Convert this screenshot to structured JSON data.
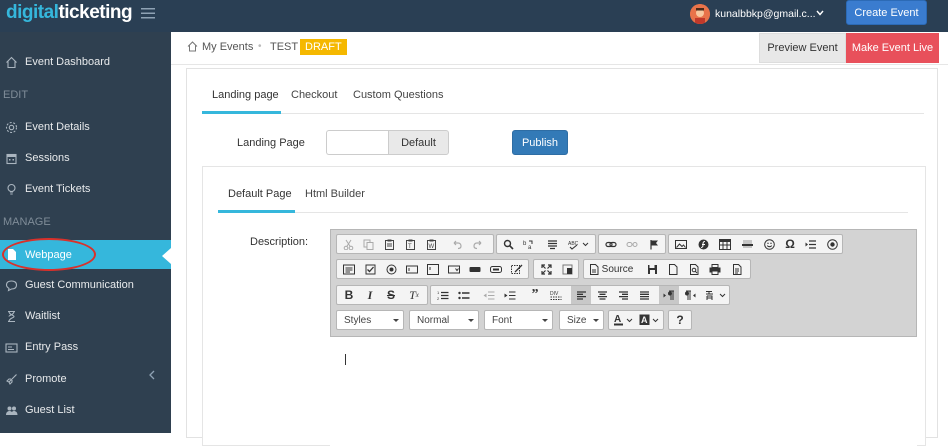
{
  "brand": {
    "logo_part1": "digital",
    "logo_part2": "ticketing"
  },
  "header": {
    "user_email": "kunalbbkp@gmail.c...",
    "create_event_label": "Create Event"
  },
  "sidebar": {
    "dashboard": "Event Dashboard",
    "section_edit": "EDIT",
    "event_details": "Event Details",
    "sessions": "Sessions",
    "event_tickets": "Event Tickets",
    "section_manage": "MANAGE",
    "webpage": "Webpage",
    "guest_communication": "Guest Communication",
    "waitlist": "Waitlist",
    "entry_pass": "Entry Pass",
    "promote": "Promote",
    "guest_list": "Guest List"
  },
  "breadcrumb": {
    "my_events": "My Events",
    "separator": "•",
    "event_name": "TEST",
    "status_badge": "DRAFT"
  },
  "actions": {
    "preview": "Preview Event",
    "make_live": "Make Event Live"
  },
  "tabs": {
    "landing_page": "Landing page",
    "checkout": "Checkout",
    "custom_questions": "Custom Questions"
  },
  "landing": {
    "label": "Landing Page",
    "input_value": "",
    "default_button": "Default",
    "publish_button": "Publish"
  },
  "subtabs": {
    "default_page": "Default Page",
    "html_builder": "Html Builder"
  },
  "description": {
    "label": "Description:",
    "content": ""
  },
  "editor": {
    "source_label": "Source",
    "styles_combo": "Styles",
    "format_combo": "Normal",
    "font_combo": "Font",
    "size_combo": "Size"
  },
  "colors": {
    "accent": "#35b7dc",
    "sidebar_bg": "#2f4050",
    "topbar_bg": "#2a3f54",
    "danger": "#e8505b",
    "primary": "#337ab7",
    "draft": "#f5b800"
  }
}
